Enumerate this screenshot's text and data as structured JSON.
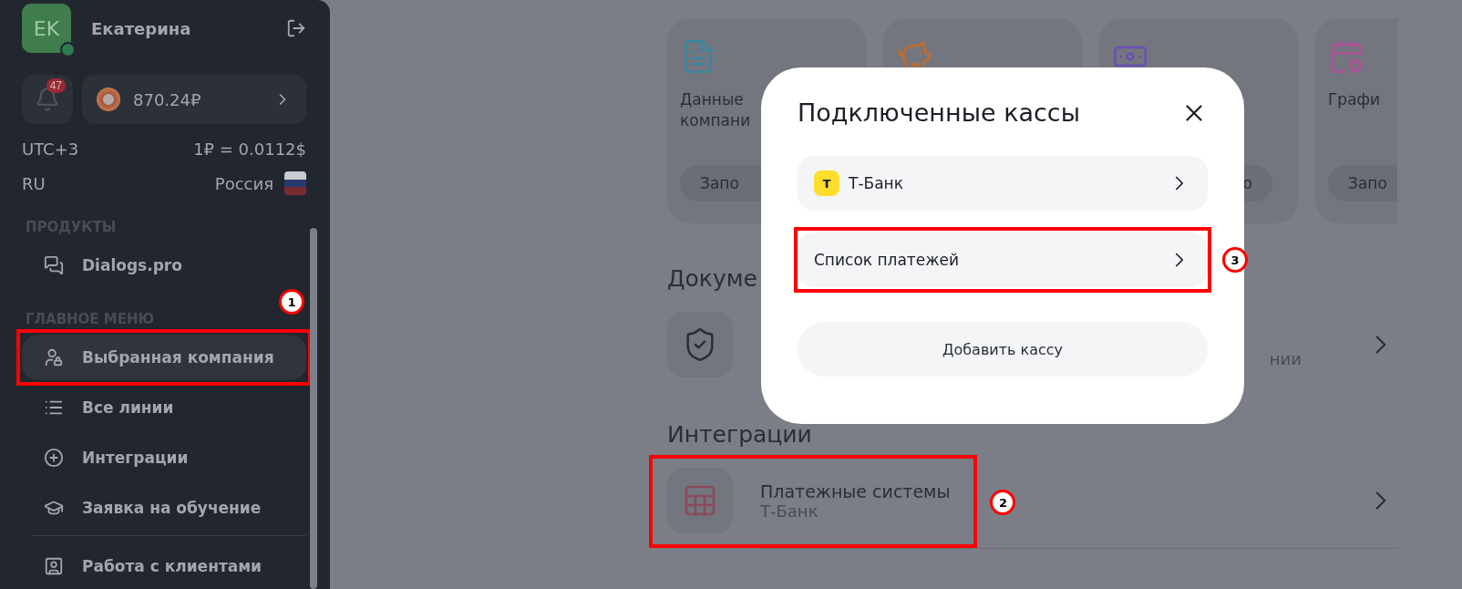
{
  "user": {
    "initials": "EK",
    "name": "Екатерина",
    "online": true
  },
  "notifications": {
    "count": "47"
  },
  "balance": {
    "amount": "870.24₽"
  },
  "info": [
    {
      "left": "UTC+3",
      "right": "1₽ = 0.0112$"
    },
    {
      "left": "RU",
      "right": "Россия",
      "flag": true
    }
  ],
  "sections": [
    {
      "title": "ПРОДУКТЫ",
      "items": [
        {
          "label": "Dialogs.pro",
          "selected": false
        }
      ]
    },
    {
      "title": "ГЛАВНОЕ МЕНЮ",
      "items": [
        {
          "label": "Выбранная компания",
          "selected": true,
          "annotation": "1"
        },
        {
          "label": "Все линии",
          "selected": false
        },
        {
          "label": "Интеграции",
          "selected": false
        },
        {
          "label": "Заявка на обучение",
          "selected": false,
          "divider": true
        },
        {
          "label": "Работа с клиентами",
          "selected": false
        }
      ]
    }
  ],
  "cards": [
    {
      "kind": "feature",
      "title": [
        "Данные",
        "компани"
      ],
      "button": "Запо"
    },
    {
      "kind": "feature"
    },
    {
      "kind": "feature",
      "button": "о"
    },
    {
      "kind": "feature",
      "title": [
        "Графи"
      ],
      "button": "Запо"
    }
  ],
  "documents": {
    "heading": "Докуме",
    "rows": [
      {
        "subtitle": "нии"
      }
    ]
  },
  "integrations": {
    "heading": "Интеграции",
    "rows": [
      {
        "title": "Платежные системы",
        "subtitle": "Т-Банк",
        "annotation": "2"
      }
    ]
  },
  "modal": {
    "title": "Подключенные кассы",
    "rows": [
      {
        "logo": "т",
        "label": "Т-Банк"
      },
      {
        "label": "Список платежей",
        "annotation": "3"
      }
    ],
    "button": "Добавить кассу"
  }
}
